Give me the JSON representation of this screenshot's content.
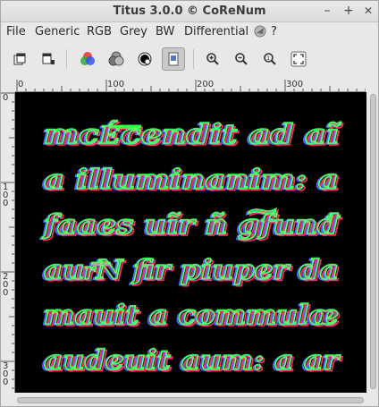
{
  "window": {
    "title": "Titus 3.0.0 © CoReNum",
    "controls": {
      "minimize": "–",
      "maximize": "+",
      "close": "✕"
    }
  },
  "menu": [
    "File",
    "Generic",
    "RGB",
    "Grey",
    "BW",
    "Differential",
    "?"
  ],
  "toolbar": {
    "buttons": [
      "open-icon",
      "export-icon",
      "rgb-wheel-icon",
      "grey-channels-icon",
      "bw-icon",
      "differential-icon",
      "zoom-in-icon",
      "zoom-out-icon",
      "zoom-fit-icon",
      "zoom-reset-icon"
    ],
    "active": "differential-icon"
  },
  "rulers": {
    "top_labels": [
      "0",
      "100",
      "200",
      "300"
    ],
    "left_labels": [
      "0",
      "100",
      "200",
      "300"
    ]
  },
  "image": {
    "lines": [
      "mcÉ͞cendit ad aĩ",
      "a illuminanim: a",
      "faaes uĩr ñ g͠funđ",
      "aur͞N fir piuper da",
      "mauit a commulœ",
      "audeuit aum: a ar"
    ],
    "colors": {
      "red": "#ff2a6a",
      "green": "#34ff4a",
      "blue": "#4b6bff",
      "white": "#f2f2ff"
    }
  }
}
